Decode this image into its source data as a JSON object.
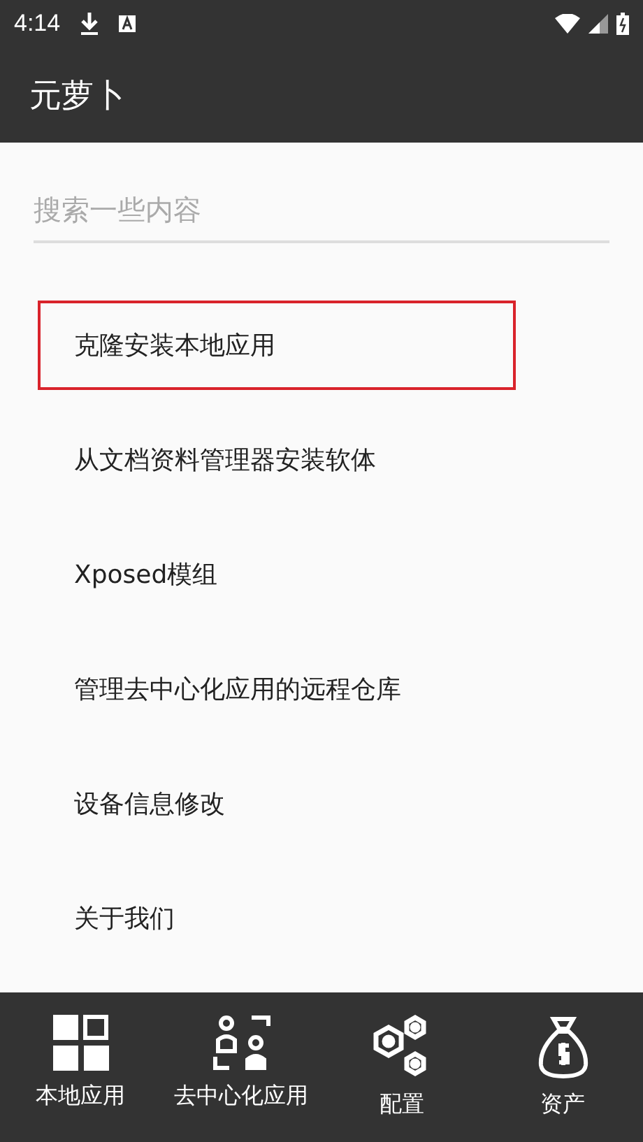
{
  "status_bar": {
    "time": "4:14"
  },
  "app_bar": {
    "title": "元萝卜"
  },
  "search": {
    "placeholder": "搜索一些内容"
  },
  "menu_items": [
    {
      "label": "克隆安装本地应用",
      "highlighted": true
    },
    {
      "label": "从文档资料管理器安装软体",
      "highlighted": false
    },
    {
      "label": "Xposed模组",
      "highlighted": false
    },
    {
      "label": "管理去中心化应用的远程仓库",
      "highlighted": false
    },
    {
      "label": "设备信息修改",
      "highlighted": false
    },
    {
      "label": "关于我们",
      "highlighted": false
    }
  ],
  "bottom_nav": [
    {
      "kind": "grid",
      "label": "本地应用"
    },
    {
      "kind": "people",
      "label": "去中心化应用"
    },
    {
      "kind": "hex",
      "label": "配置"
    },
    {
      "kind": "bag",
      "label": "资产"
    }
  ]
}
